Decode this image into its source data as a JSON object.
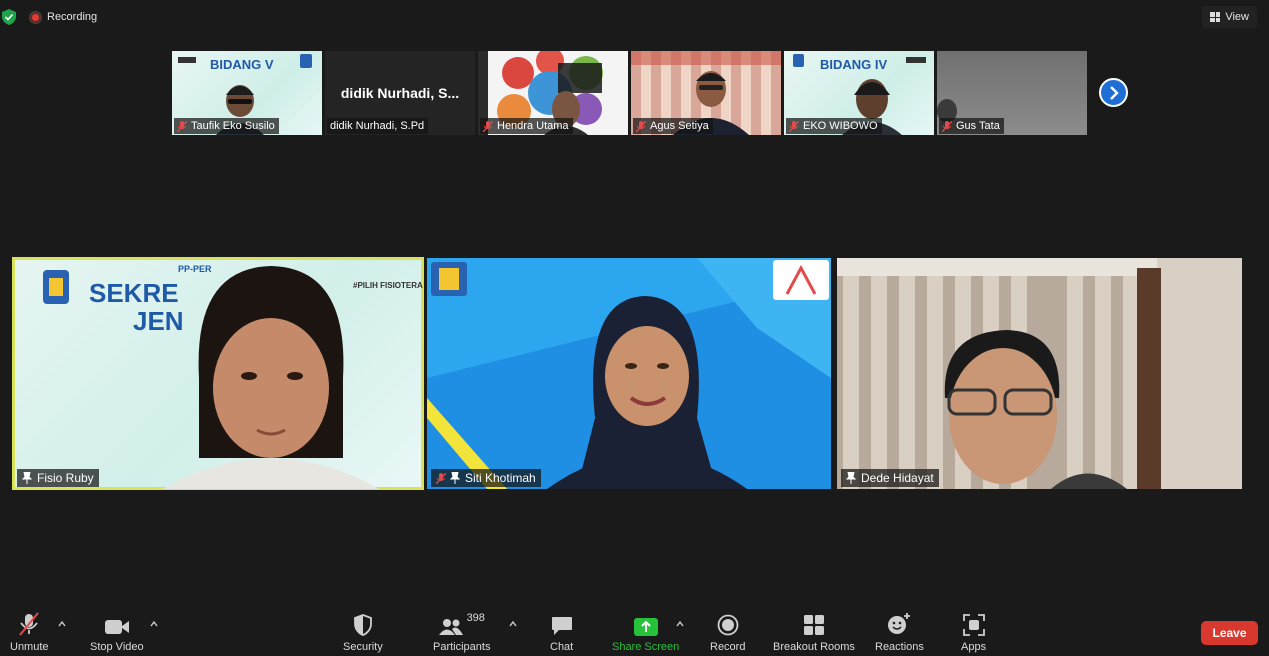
{
  "top_bar": {
    "recording_label": "Recording",
    "view_label": "View"
  },
  "strip": [
    {
      "name": "Taufik Eko Susilo",
      "muted": true,
      "banner": "BIDANG V"
    },
    {
      "name": "didik Nurhadi, S.Pd",
      "muted": false,
      "display_name": "didik  Nurhadi,  S..."
    },
    {
      "name": "Hendra Utama",
      "muted": true
    },
    {
      "name": "Agus Setiya",
      "muted": true
    },
    {
      "name": "EKO WIBOWO",
      "muted": true,
      "banner": "BIDANG IV"
    },
    {
      "name": "Gus Tata",
      "muted": true
    }
  ],
  "tiles": [
    {
      "name": "Fisio Ruby",
      "pinned": true,
      "active": true,
      "banner_line1": "SEKRE",
      "banner_line2": "JEN",
      "banner_top": "PP-PER",
      "tag": "#PILIH FISIOTERAPI"
    },
    {
      "name": "Siti Khotimah",
      "muted": true,
      "pinned": true
    },
    {
      "name": "Dede Hidayat",
      "pinned": true
    }
  ],
  "toolbar": {
    "unmute": "Unmute",
    "stop_video": "Stop Video",
    "security": "Security",
    "participants": "Participants",
    "participants_count": "398",
    "chat": "Chat",
    "share_screen": "Share Screen",
    "record": "Record",
    "breakout_rooms": "Breakout Rooms",
    "reactions": "Reactions",
    "apps": "Apps",
    "leave": "Leave"
  },
  "colors": {
    "active_speaker": "#d8e35a",
    "share_green": "#27c13b",
    "leave_red": "#d9382e",
    "next_blue": "#1e6ed6"
  }
}
